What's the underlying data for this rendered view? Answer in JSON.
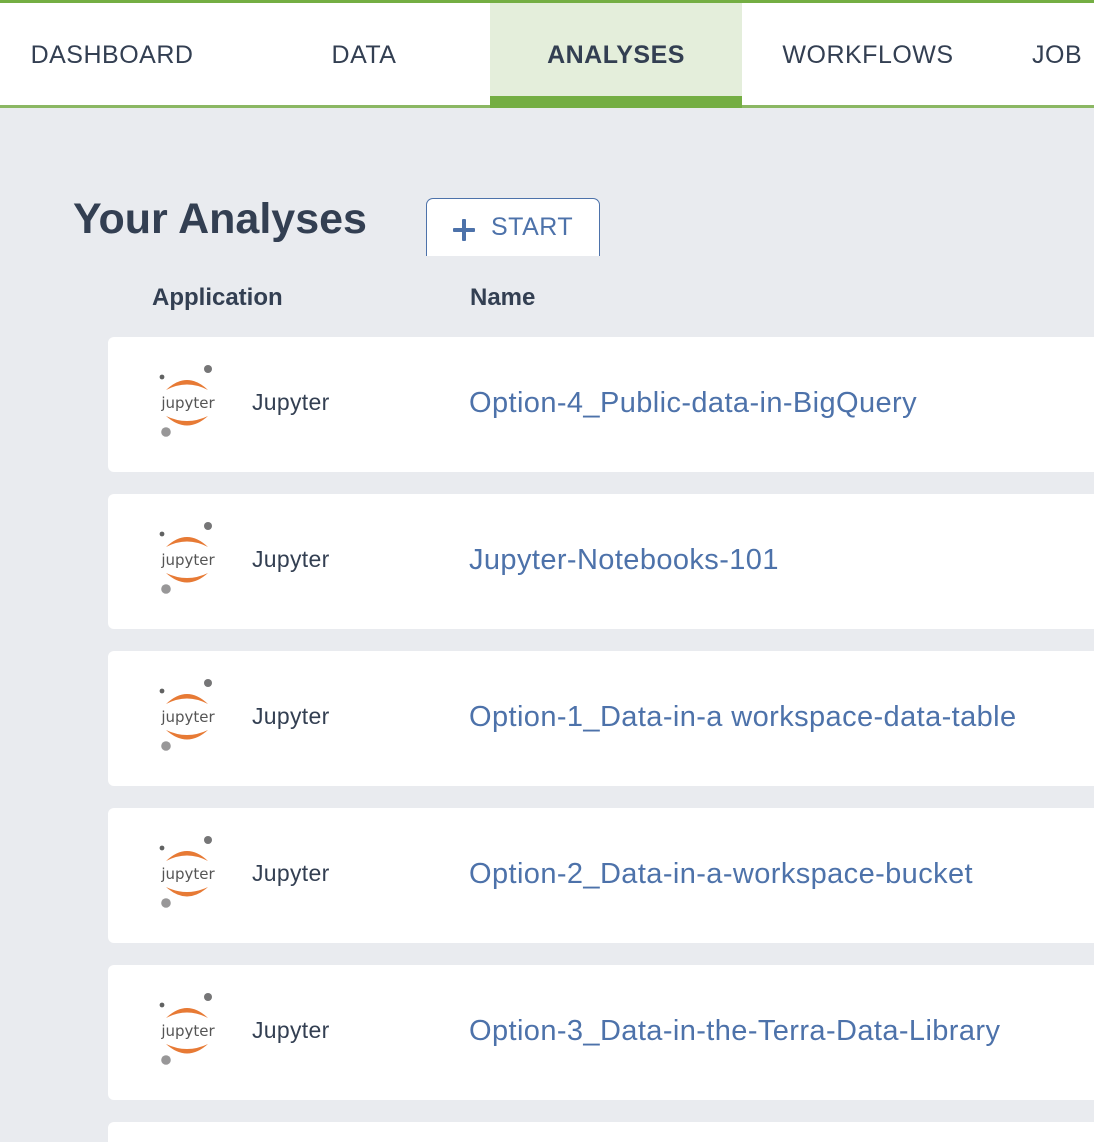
{
  "tabs": [
    {
      "label": "DASHBOARD",
      "active": false
    },
    {
      "label": "DATA",
      "active": false
    },
    {
      "label": "ANALYSES",
      "active": true
    },
    {
      "label": "WORKFLOWS",
      "active": false
    },
    {
      "label": "JOB",
      "active": false
    }
  ],
  "page": {
    "title": "Your Analyses",
    "start_button_label": "START",
    "start_button_icon": "plus-icon"
  },
  "columns": {
    "application": "Application",
    "name": "Name"
  },
  "analyses": [
    {
      "app": "Jupyter",
      "logo_text": "jupyter",
      "name": "Option-4_Public-data-in-BigQuery"
    },
    {
      "app": "Jupyter",
      "logo_text": "jupyter",
      "name": "Jupyter-Notebooks-101"
    },
    {
      "app": "Jupyter",
      "logo_text": "jupyter",
      "name": "Option-1_Data-in-a workspace-data-table"
    },
    {
      "app": "Jupyter",
      "logo_text": "jupyter",
      "name": "Option-2_Data-in-a-workspace-bucket"
    },
    {
      "app": "Jupyter",
      "logo_text": "jupyter",
      "name": "Option-3_Data-in-the-Terra-Data-Library"
    }
  ],
  "colors": {
    "accent_green": "#74ae43",
    "active_tab_bg": "#e4eedb",
    "link_blue": "#4d72aa",
    "text_dark": "#333f52",
    "jupyter_orange": "#e77a35"
  }
}
